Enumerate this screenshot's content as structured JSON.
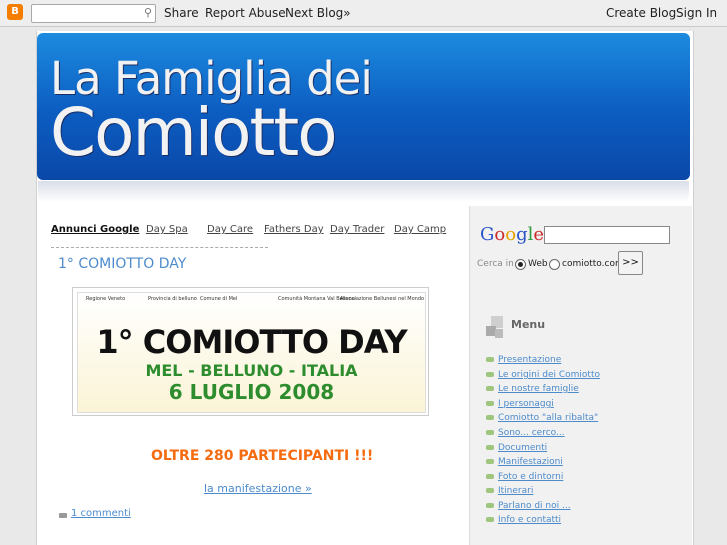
{
  "navbar": {
    "logo": "B",
    "search_placeholder": "",
    "share": "Share",
    "report": "Report Abuse",
    "next": "Next Blog»",
    "create": "Create Blog",
    "signin": "Sign In"
  },
  "header": {
    "title_line1": "La Famiglia dei",
    "title_line2": "Comiotto"
  },
  "ads": {
    "heading": "Annunci Google",
    "links": [
      "Day Spa",
      "Day Care",
      "Fathers Day",
      "Day Trader",
      "Day Camp"
    ]
  },
  "post": {
    "title": "1° COMIOTTO DAY",
    "banner": {
      "logos": [
        "Regione Veneto",
        "Provincia di belluno",
        "Comune di Mel",
        "Comunità Montana Val Belluna",
        "Associazione Bellunesi nel Mondo"
      ],
      "main": "1° COMIOTTO DAY",
      "line2": "MEL - BELLUNO - ITALIA",
      "line3": "6 LUGLIO 2008"
    },
    "partecipanti": "OLTRE 280 PARTECIPANTI !!!",
    "link": "la manifestazione »",
    "comments": "1 commenti"
  },
  "google_search": {
    "logo": "Google",
    "cerca": "Cerca in",
    "opt_web": "Web",
    "opt_site": "comiotto.com",
    "button": ">>"
  },
  "menu": {
    "title": "Menu",
    "items": [
      "Presentazione",
      "Le origini dei Comiotto",
      "Le nostre famiglie",
      "I personaggi",
      "Comiotto \"alla ribalta\"",
      "Sono... cerco...",
      "Documenti",
      "Manifestazioni",
      "Foto e dintorni",
      "Itinerari",
      "Parlano di noi ...",
      "Info e contatti"
    ]
  },
  "colors": {
    "header_blue": "#0c5cc0",
    "link_blue": "#4d8bcb",
    "orange": "#f56b10",
    "green": "#2d8d2e"
  }
}
